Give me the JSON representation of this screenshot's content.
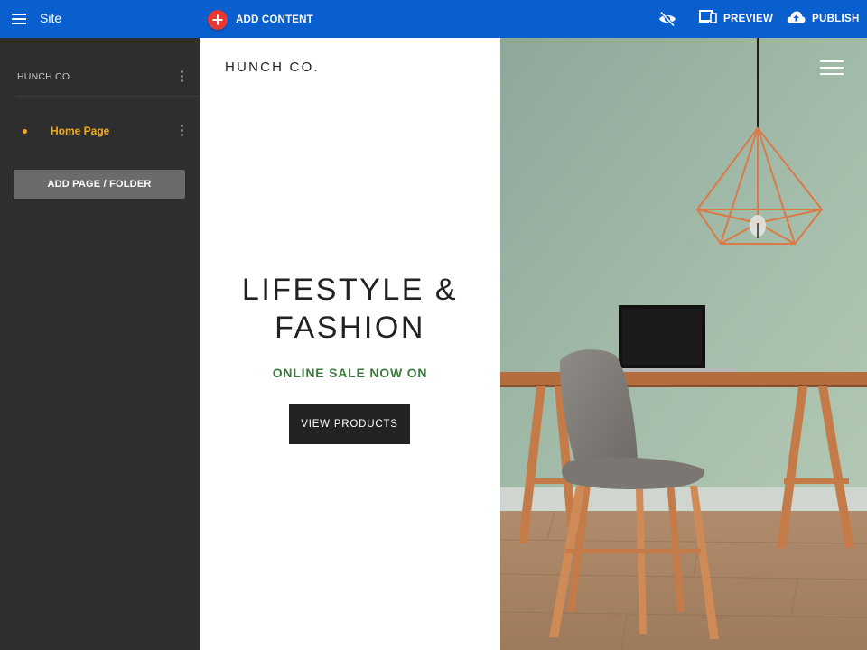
{
  "topbar": {
    "menu_icon": "menu-icon",
    "title": "Site",
    "add_content_label": "ADD CONTENT",
    "add_icon": "plus-icon",
    "visibility_icon": "eye-off-icon",
    "preview_label": "PREVIEW",
    "preview_icon": "devices-icon",
    "publish_label": "PUBLISH",
    "publish_icon": "cloud-upload-icon",
    "bg_color": "#0a5fcf",
    "add_color": "#e53935"
  },
  "sidebar": {
    "site_name": "HUNCH CO.",
    "pages": [
      {
        "label": "Home Page",
        "active": true
      }
    ],
    "add_page_label": "ADD PAGE / FOLDER",
    "active_color": "#f2a91d",
    "bg_color": "#2e2e2e"
  },
  "preview": {
    "brand": "HUNCH CO.",
    "hero_title_line1": "LIFESTYLE &",
    "hero_title_line2": "FASHION",
    "hero_subtitle": "ONLINE SALE NOW ON",
    "cta_label": "VIEW PRODUCTS",
    "accent_color": "#3c7a3e",
    "image_subject": "desk with laptop, grey chair and copper pendant lamp against sage green wall"
  }
}
